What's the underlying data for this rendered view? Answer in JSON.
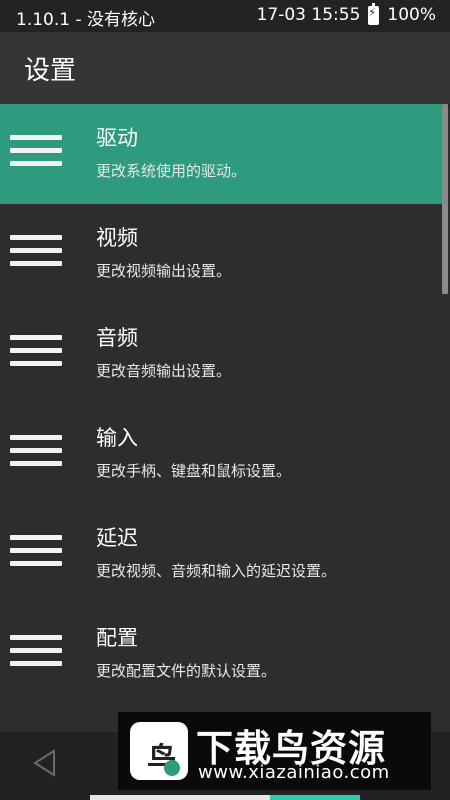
{
  "status_bar": {
    "left_text": "1.10.1 - 没有核心",
    "datetime": "17-03 15:55",
    "battery": "100%"
  },
  "app_bar": {
    "title": "设置"
  },
  "settings_list": [
    {
      "title": "驱动",
      "subtitle": "更改系统使用的驱动。",
      "selected": true
    },
    {
      "title": "视频",
      "subtitle": "更改视频输出设置。",
      "selected": false
    },
    {
      "title": "音频",
      "subtitle": "更改音频输出设置。",
      "selected": false
    },
    {
      "title": "输入",
      "subtitle": "更改手柄、键盘和鼠标设置。",
      "selected": false
    },
    {
      "title": "延迟",
      "subtitle": "更改视频、音频和输入的延迟设置。",
      "selected": false
    },
    {
      "title": "配置",
      "subtitle": "更改配置文件的默认设置。",
      "selected": false
    }
  ],
  "watermark": {
    "logo_char": "鸟",
    "title": "下载鸟资源",
    "url": "www.xiazainiao.com"
  },
  "colors": {
    "accent": "#2e9a7f",
    "background": "#2d2d2d",
    "app_bar": "#353535",
    "status_bar": "#232323"
  },
  "icons": {
    "list_item": "menu-lines-icon",
    "nav_back": "back-triangle-icon",
    "battery": "battery-charging-icon"
  }
}
